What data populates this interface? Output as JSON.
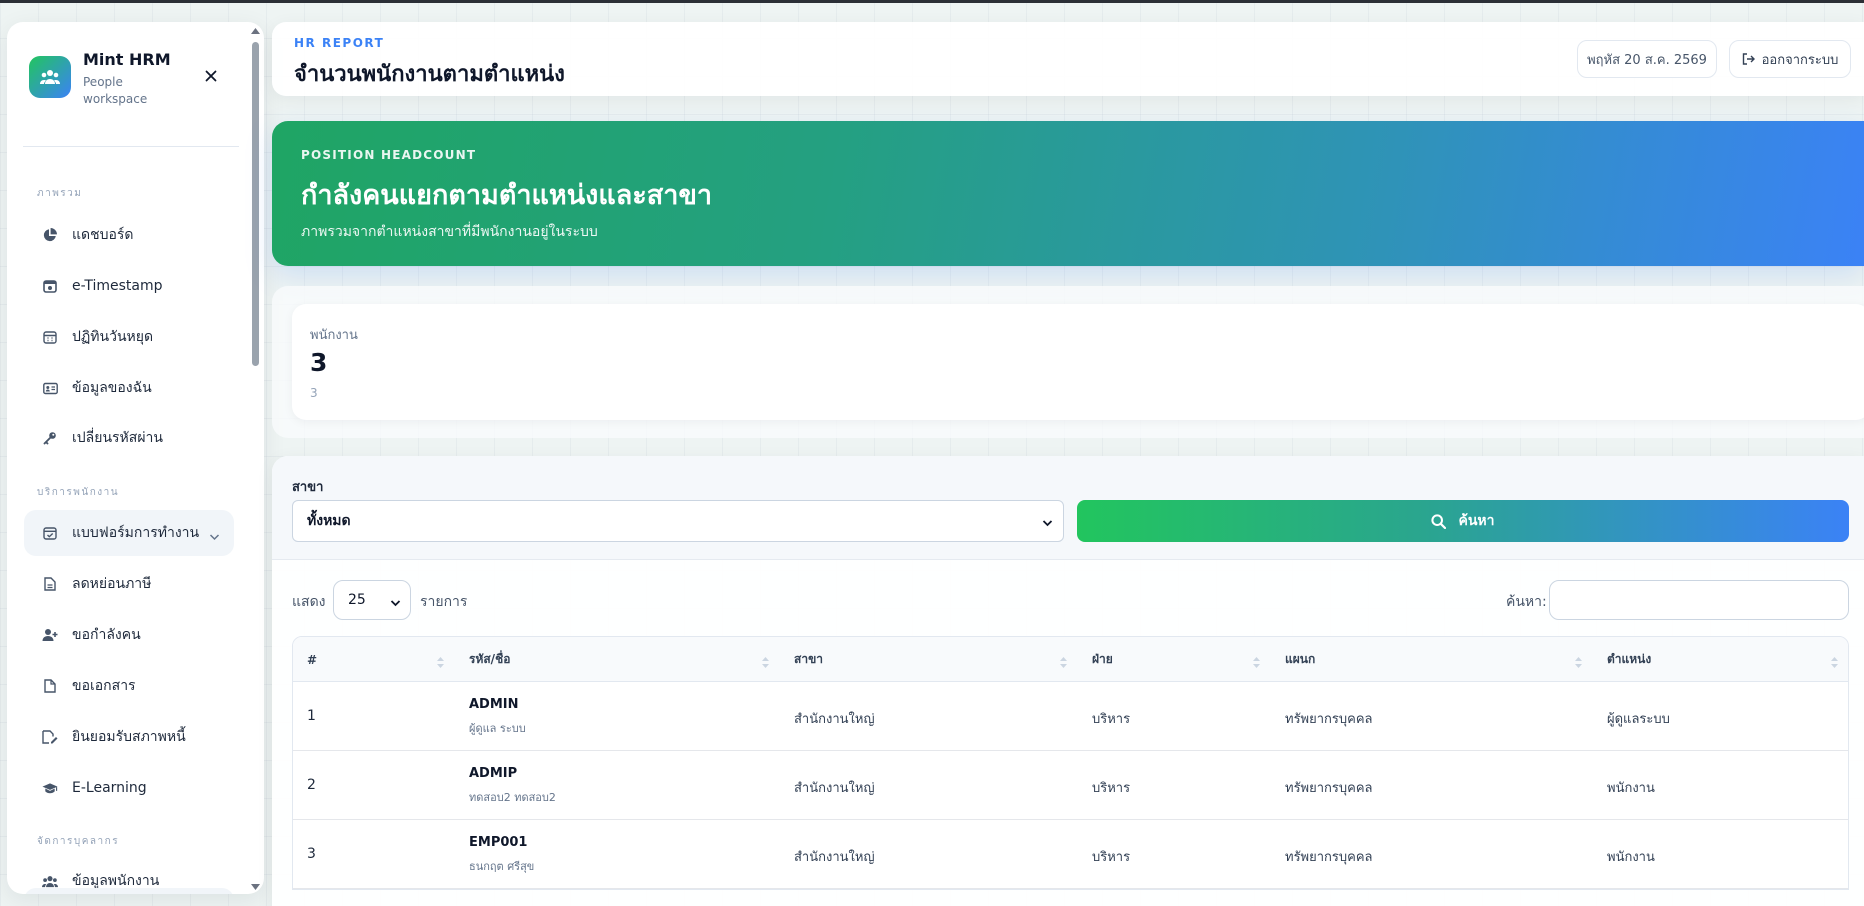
{
  "brand": {
    "name": "Mint HRM",
    "subtitle": "People workspace"
  },
  "sidebar": {
    "sections": [
      {
        "title": "ภาพรวม",
        "items": [
          {
            "label": "แดชบอร์ด",
            "icon": "chart-pie-icon"
          },
          {
            "label": "e-Timestamp",
            "icon": "calendar-clock-icon"
          },
          {
            "label": "ปฏิทินวันหยุด",
            "icon": "calendar-icon"
          },
          {
            "label": "ข้อมูลของฉัน",
            "icon": "id-card-icon"
          },
          {
            "label": "เปลี่ยนรหัสผ่าน",
            "icon": "key-icon"
          }
        ]
      },
      {
        "title": "บริการพนักงาน",
        "items": [
          {
            "label": "แบบฟอร์มการทำงาน",
            "icon": "calendar-check-icon",
            "active": true
          },
          {
            "label": "ลดหย่อนภาษี",
            "icon": "file-icon"
          },
          {
            "label": "ขอกำลังคน",
            "icon": "user-plus-icon"
          },
          {
            "label": "ขอเอกสาร",
            "icon": "document-icon"
          },
          {
            "label": "ยินยอมรับสภาพหนี้",
            "icon": "signature-icon"
          },
          {
            "label": "E-Learning",
            "icon": "graduation-cap-icon"
          }
        ]
      },
      {
        "title": "จัดการบุคลากร",
        "items": [
          {
            "label": "ข้อมูลพนักงาน",
            "icon": "users-icon"
          }
        ]
      }
    ]
  },
  "header": {
    "eyebrow": "HR REPORT",
    "title": "จำนวนพนักงานตามตำแหน่ง",
    "date": "พฤหัส 20 ส.ค. 2569",
    "logout_label": "ออกจากระบบ"
  },
  "hero": {
    "eyebrow": "POSITION HEADCOUNT",
    "title": "กำลังคนแยกตามตำแหน่งและสาขา",
    "subtitle": "ภาพรวมจากตำแหน่งสาขาที่มีพนักงานอยู่ในระบบ"
  },
  "stat": {
    "label": "พนักงาน",
    "value": "3",
    "footnote": "3"
  },
  "filter": {
    "branch_label": "สาขา",
    "branch_value": "ทั้งหมด",
    "search_button": "ค้นหา"
  },
  "table_controls": {
    "show_label": "แสดง",
    "page_size": "25",
    "entries_label": "รายการ",
    "search_label": "ค้นหา:",
    "search_value": ""
  },
  "table": {
    "columns": [
      "#",
      "รหัส/ชื่อ",
      "สาขา",
      "ฝ่าย",
      "แผนก",
      "ตำแหน่ง"
    ],
    "rows": [
      {
        "num": "1",
        "code": "ADMIN",
        "name": "ผู้ดูแล ระบบ",
        "branch": "สำนักงานใหญ่",
        "division": "บริหาร",
        "department": "ทรัพยากรบุคคล",
        "position": "ผู้ดูแลระบบ"
      },
      {
        "num": "2",
        "code": "ADMIP",
        "name": "ทดสอบ2 ทดสอบ2",
        "branch": "สำนักงานใหญ่",
        "division": "บริหาร",
        "department": "ทรัพยากรบุคคล",
        "position": "พนักงาน"
      },
      {
        "num": "3",
        "code": "EMP001",
        "name": "ธนกฤต ศรีสุข",
        "branch": "สำนักงานใหญ่",
        "division": "บริหาร",
        "department": "ทรัพยากรบุคคล",
        "position": "พนักงาน"
      }
    ]
  },
  "colors": {
    "accent_green": "#22c55e",
    "accent_blue": "#3b82f6",
    "text_dark": "#0f172a"
  }
}
